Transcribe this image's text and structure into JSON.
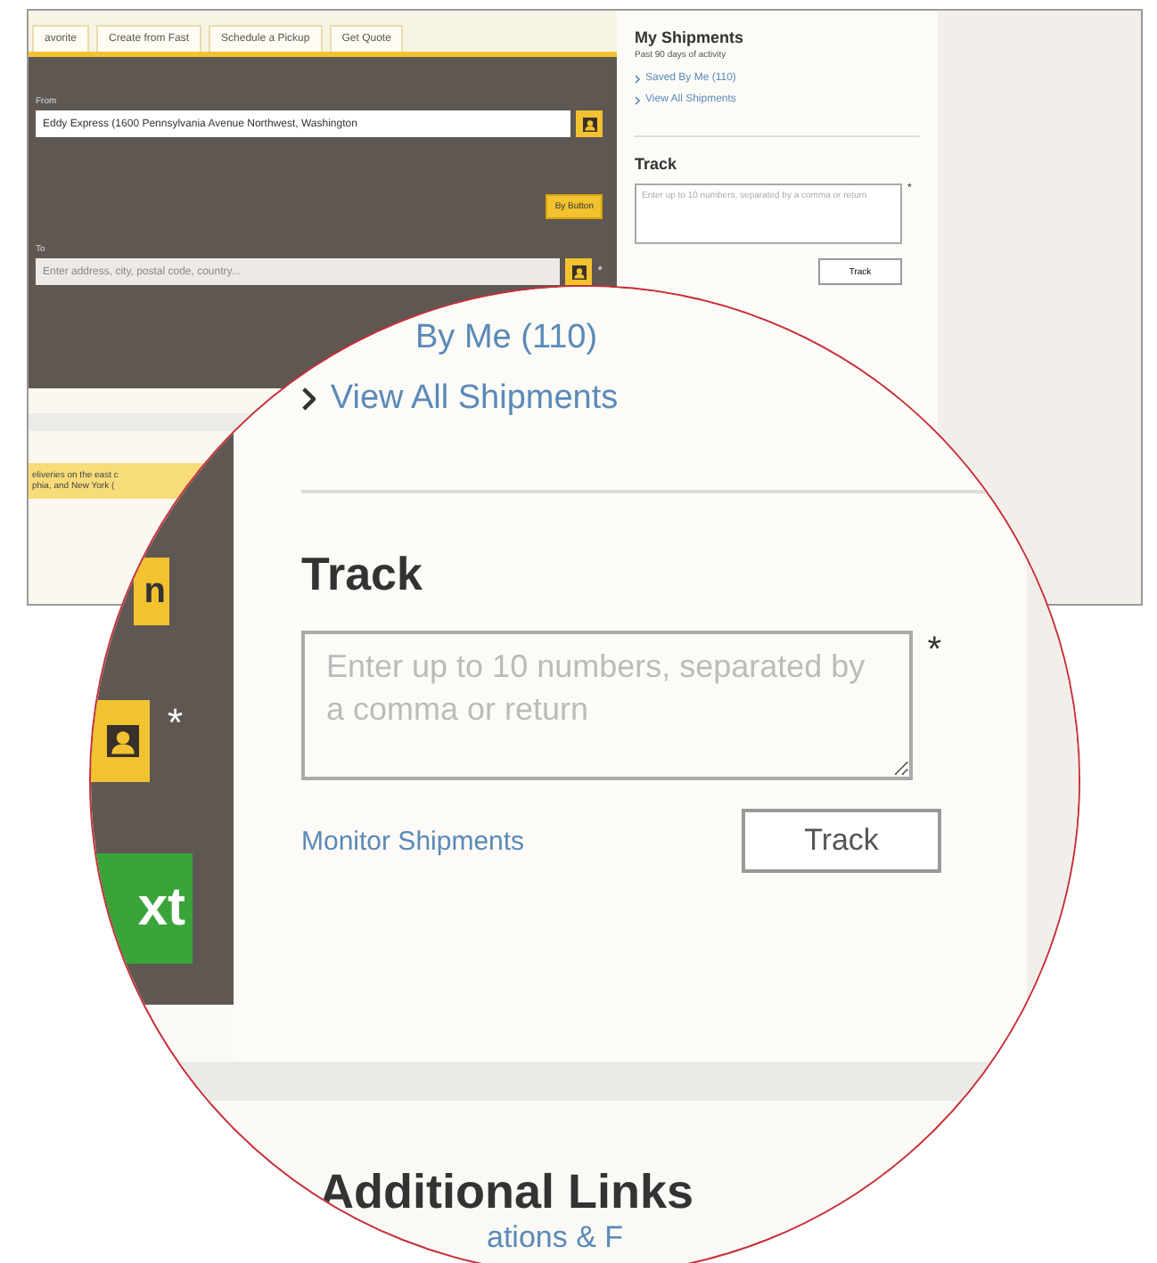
{
  "background_page": {
    "tabs": [
      {
        "label": "avorite",
        "selected": false
      },
      {
        "label": "Create from Fast",
        "selected": false
      },
      {
        "label": "Schedule a Pickup",
        "selected": false
      },
      {
        "label": "Get Quote",
        "selected": false
      }
    ],
    "from": {
      "label": "From",
      "value": "Eddy Express (1600 Pennsylvania Avenue Northwest, Washington"
    },
    "small_button": "By Button",
    "to": {
      "label": "To",
      "placeholder": "Enter address, city, postal code, country...",
      "required_mark": "*"
    },
    "notice": [
      "eliveries on the east c",
      "phia, and New York ("
    ],
    "sidebar": {
      "title": "My Shipments",
      "subtitle": "Past 90 days of activity",
      "links": [
        "Saved By Me (110)",
        "View All Shipments"
      ],
      "track": {
        "title": "Track",
        "placeholder": "Enter up to 10 numbers, separated by a comma or return",
        "required_mark": "*",
        "button": "Track"
      }
    }
  },
  "magnifier": {
    "left_panel": {
      "button_1": "n",
      "required_mark": "*",
      "next_button": "xt"
    },
    "links": [
      "By Me (110)",
      "View All Shipments"
    ],
    "track": {
      "title": "Track",
      "placeholder": "Enter up to 10 numbers, separated by a comma or return",
      "required_mark": "*",
      "link": "Monitor Shipments",
      "button": "Track"
    },
    "additional_links": {
      "title": "Additional Links",
      "items": [
        "ations & F"
      ]
    }
  }
}
